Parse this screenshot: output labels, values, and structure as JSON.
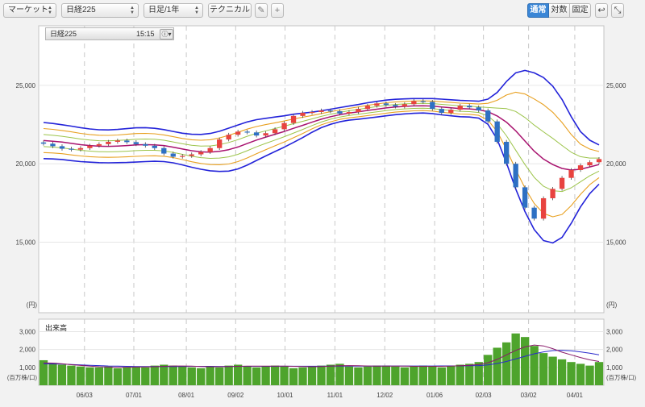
{
  "toolbar": {
    "market_select": "マーケット",
    "symbol_select": "日経225",
    "period_select": "日足/1年",
    "technical_button": "テクニカル",
    "view_modes": [
      "通常",
      "対数",
      "固定"
    ],
    "active_view_mode": "通常"
  },
  "legend": {
    "symbol": "日経225",
    "time": "15:15",
    "info_icon": "info-icon"
  },
  "colors": {
    "up": "#e8433f",
    "down": "#2e70c3",
    "bollinger_outer": "#2323d9",
    "bollinger_mid": "#e8a020",
    "bollinger_inner": "#9cc44a",
    "moving_average": "#a8136f",
    "volume_bar": "#4ea42c",
    "volume_ma1": "#2a2acc",
    "volume_ma2": "#8a1a6a"
  },
  "chart_data": [
    {
      "type": "candlestick",
      "symbol": "日経225",
      "price_unit": "(円)",
      "y_ticks": [
        "25,000",
        "20,000",
        "15,000"
      ],
      "ylim": [
        10500,
        28800
      ],
      "x_ticks": [
        "06/03",
        "07/01",
        "08/01",
        "09/02",
        "10/01",
        "11/01",
        "12/02",
        "01/06",
        "02/03",
        "03/02",
        "04/01"
      ],
      "weekly_close": [
        21280,
        21120,
        20960,
        20900,
        21000,
        21150,
        21250,
        21400,
        21480,
        21380,
        21250,
        21150,
        21000,
        20650,
        20450,
        20500,
        20600,
        20750,
        21000,
        21550,
        21850,
        22050,
        22000,
        21800,
        21950,
        22200,
        22600,
        23050,
        23250,
        23300,
        23400,
        23350,
        23200,
        23300,
        23500,
        23700,
        23850,
        23750,
        23650,
        23800,
        24000,
        23950,
        23500,
        23250,
        23450,
        23700,
        23600,
        23400,
        22700,
        21400,
        20000,
        18500,
        17200,
        16500,
        17800,
        18400,
        19100,
        19600,
        19900,
        20100,
        20300
      ],
      "moving_average": [
        21480,
        21440,
        21380,
        21300,
        21220,
        21160,
        21120,
        21110,
        21130,
        21160,
        21200,
        21220,
        21210,
        21160,
        21060,
        20940,
        20830,
        20760,
        20740,
        20790,
        20900,
        21070,
        21290,
        21510,
        21700,
        21880,
        22060,
        22260,
        22450,
        22650,
        22840,
        23000,
        23130,
        23230,
        23310,
        23400,
        23480,
        23560,
        23620,
        23660,
        23690,
        23700,
        23680,
        23620,
        23570,
        23520,
        23500,
        23450,
        23320,
        23050,
        22650,
        22100,
        21450,
        20800,
        20300,
        19950,
        19700,
        19600,
        19650,
        19800,
        19950
      ],
      "band_outer_half_width": [
        1150,
        1130,
        1110,
        1100,
        1080,
        1060,
        1050,
        1050,
        1060,
        1080,
        1090,
        1080,
        1050,
        1020,
        1000,
        1010,
        1050,
        1110,
        1190,
        1280,
        1370,
        1400,
        1380,
        1300,
        1200,
        1100,
        1000,
        900,
        780,
        640,
        540,
        480,
        450,
        450,
        470,
        490,
        500,
        500,
        490,
        480,
        470,
        460,
        480,
        500,
        510,
        520,
        520,
        540,
        800,
        1500,
        2600,
        3700,
        4500,
        5000,
        5200,
        5000,
        4400,
        3400,
        2400,
        1700,
        1250
      ]
    },
    {
      "type": "bar",
      "title": "出来高",
      "unit": "(百万株/口)",
      "y_ticks": [
        "3,000",
        "2,000",
        "1,000"
      ],
      "ylim": [
        0,
        3700
      ],
      "weekly_volume": [
        1400,
        1250,
        1150,
        1100,
        1050,
        1000,
        1000,
        1050,
        950,
        1000,
        1050,
        1000,
        1100,
        1150,
        1100,
        1050,
        1000,
        950,
        1050,
        1000,
        1100,
        1150,
        1050,
        1000,
        1050,
        1100,
        1050,
        950,
        1000,
        1050,
        1100,
        1150,
        1200,
        1050,
        1000,
        1050,
        1100,
        1100,
        1050,
        1000,
        1050,
        1100,
        1050,
        1000,
        1100,
        1150,
        1200,
        1300,
        1700,
        2100,
        2400,
        2900,
        2700,
        2200,
        1800,
        1600,
        1450,
        1300,
        1200,
        1100,
        1300
      ],
      "volume_ma_short": [
        1250,
        1240,
        1200,
        1150,
        1110,
        1070,
        1040,
        1020,
        1010,
        1010,
        1020,
        1030,
        1040,
        1060,
        1080,
        1080,
        1070,
        1050,
        1040,
        1040,
        1050,
        1060,
        1070,
        1070,
        1070,
        1070,
        1070,
        1060,
        1050,
        1040,
        1050,
        1070,
        1090,
        1100,
        1090,
        1080,
        1070,
        1070,
        1070,
        1070,
        1060,
        1060,
        1060,
        1060,
        1070,
        1090,
        1120,
        1160,
        1260,
        1450,
        1700,
        1950,
        2150,
        2250,
        2200,
        2050,
        1850,
        1700,
        1550,
        1420,
        1330
      ],
      "volume_ma_long": [
        1200,
        1190,
        1180,
        1160,
        1140,
        1120,
        1100,
        1080,
        1070,
        1060,
        1050,
        1050,
        1050,
        1050,
        1050,
        1055,
        1060,
        1060,
        1060,
        1055,
        1055,
        1060,
        1060,
        1060,
        1060,
        1062,
        1064,
        1065,
        1065,
        1066,
        1067,
        1068,
        1070,
        1072,
        1074,
        1075,
        1076,
        1077,
        1078,
        1079,
        1080,
        1080,
        1080,
        1081,
        1082,
        1085,
        1090,
        1100,
        1140,
        1220,
        1330,
        1470,
        1620,
        1760,
        1870,
        1940,
        1960,
        1930,
        1870,
        1790,
        1700
      ]
    }
  ]
}
